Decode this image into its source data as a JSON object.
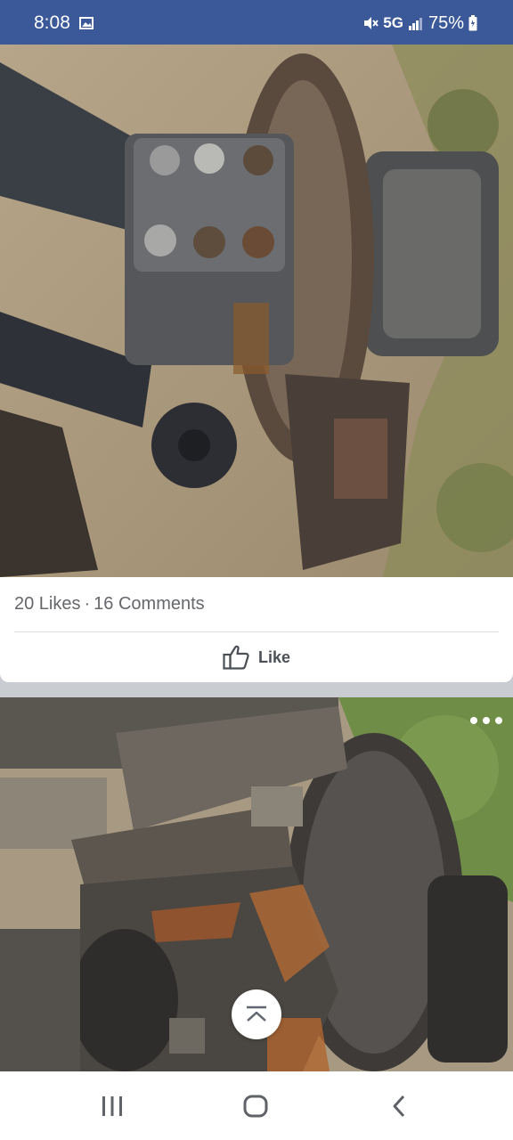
{
  "status_bar": {
    "time": "8:08",
    "network": "5G",
    "battery": "75%",
    "icons": [
      "gallery-icon",
      "mute-icon",
      "signal-icon",
      "battery-icon"
    ]
  },
  "post": {
    "likes": "20 Likes",
    "separator": "·",
    "comments": "16 Comments",
    "like_label": "Like"
  },
  "colors": {
    "status_bar": "#3b5998",
    "card": "#ffffff",
    "feed_bg": "#c9ccd1",
    "muted_text": "#65676b",
    "like_text": "#4b4f56"
  },
  "photos": [
    {
      "subject": "photo-of-front-axle-knuckle-and-brake-rotor"
    },
    {
      "subject": "photo-of-axle-knuckle-closeup-with-rotor"
    }
  ],
  "nav_bar": {
    "icons": [
      "recent-apps-icon",
      "home-icon",
      "back-icon"
    ]
  },
  "overlay_icons": [
    "more-options-icon",
    "scroll-to-top-icon"
  ]
}
